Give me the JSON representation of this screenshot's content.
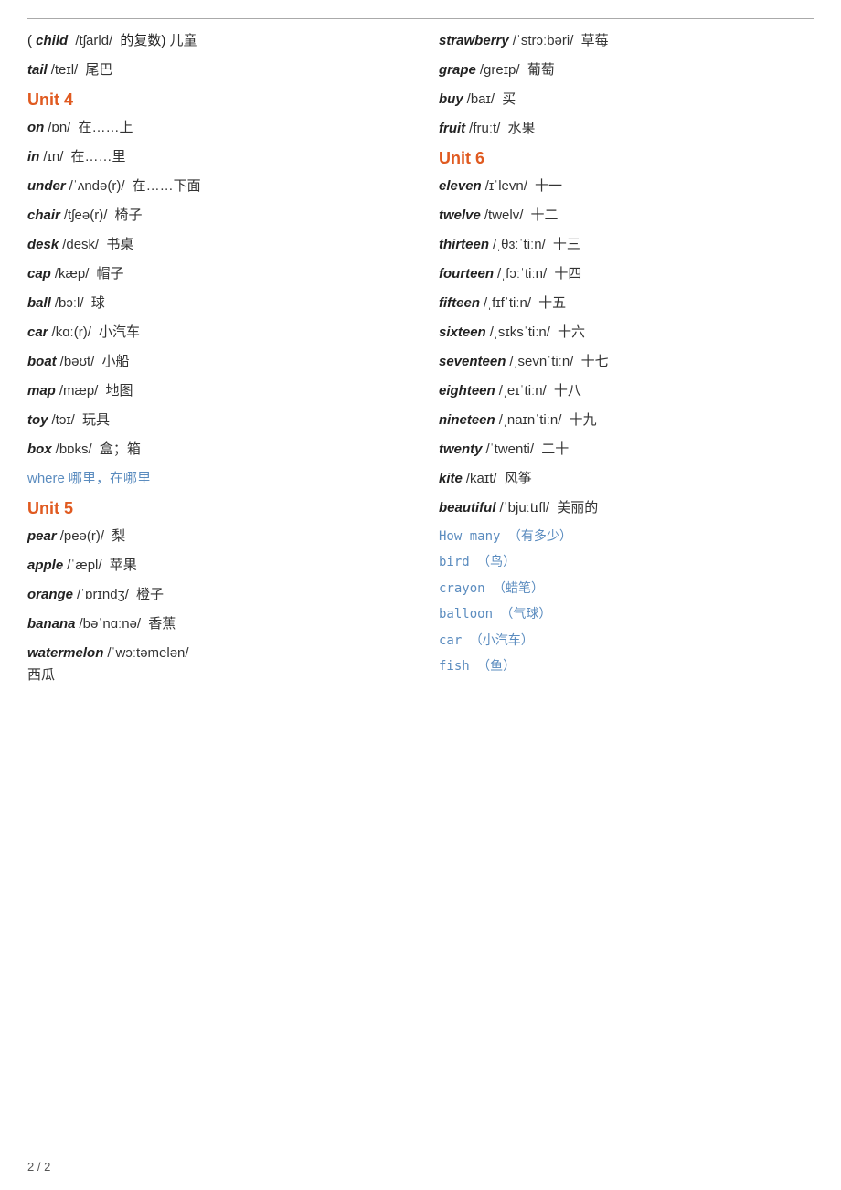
{
  "page": {
    "page_number": "2 / 2",
    "top_line": true
  },
  "left_column": [
    {
      "type": "entry",
      "word": "( child",
      "phonetic": "/tʃarld/",
      "note": "的复数)",
      "chinese": "儿童"
    },
    {
      "type": "entry",
      "word": "tail",
      "phonetic": "/teɪl/",
      "chinese": "尾巴"
    },
    {
      "type": "heading",
      "text": "Unit 4"
    },
    {
      "type": "entry",
      "word": "on",
      "phonetic": "/ɒn/",
      "chinese": "在……上"
    },
    {
      "type": "entry",
      "word": "in",
      "phonetic": "/ɪn/",
      "chinese": "在……里"
    },
    {
      "type": "entry",
      "word": "under",
      "phonetic": "/ˈʌndə(r)/",
      "chinese": "在……下面"
    },
    {
      "type": "entry",
      "word": "chair",
      "phonetic": "/tʃeə(r)/",
      "chinese": "椅子"
    },
    {
      "type": "entry",
      "word": "desk",
      "phonetic": "/desk/",
      "chinese": "书桌"
    },
    {
      "type": "entry",
      "word": "cap",
      "phonetic": "/kæp/",
      "chinese": "帽子"
    },
    {
      "type": "entry",
      "word": "ball",
      "phonetic": "/bɔːl/",
      "chinese": "球"
    },
    {
      "type": "entry",
      "word": "car",
      "phonetic": "/kɑː(r)/",
      "chinese": "小汽车"
    },
    {
      "type": "entry",
      "word": "boat",
      "phonetic": "/bəʊt/",
      "chinese": "小船"
    },
    {
      "type": "entry",
      "word": "map",
      "phonetic": "/mæp/",
      "chinese": "地图"
    },
    {
      "type": "entry",
      "word": "toy",
      "phonetic": "/tɔɪ/",
      "chinese": "玩具"
    },
    {
      "type": "entry",
      "word": "box",
      "phonetic": "/bɒks/",
      "chinese": "盒；箱"
    },
    {
      "type": "where",
      "text": "where    哪里，在哪里"
    },
    {
      "type": "heading",
      "text": "Unit 5"
    },
    {
      "type": "entry",
      "word": "pear",
      "phonetic": "/peə(r)/",
      "chinese": "梨"
    },
    {
      "type": "entry",
      "word": "apple",
      "phonetic": "/ˈæpl/",
      "chinese": "苹果"
    },
    {
      "type": "entry",
      "word": "orange",
      "phonetic": "/ˈɒrɪndʒ/",
      "chinese": "橙子"
    },
    {
      "type": "entry",
      "word": "banana",
      "phonetic": "/bəˈnɑːnə/",
      "chinese": "香蕉"
    },
    {
      "type": "entry-multiline",
      "word": "watermelon",
      "phonetic": "/ˈwɔːtəmelən/",
      "chinese": "西瓜"
    }
  ],
  "right_column": [
    {
      "type": "entry",
      "word": "strawberry",
      "phonetic": "/ˈstrɔːbəri/",
      "chinese": "草莓"
    },
    {
      "type": "entry",
      "word": "grape",
      "phonetic": "/greɪp/",
      "chinese": "葡萄"
    },
    {
      "type": "entry",
      "word": "buy",
      "phonetic": "/baɪ/",
      "chinese": "买"
    },
    {
      "type": "entry",
      "word": "fruit",
      "phonetic": "/fruːt/",
      "chinese": "水果"
    },
    {
      "type": "heading",
      "text": "Unit 6"
    },
    {
      "type": "entry",
      "word": "eleven",
      "phonetic": "/ɪˈlevn/",
      "chinese": "十一"
    },
    {
      "type": "entry",
      "word": "twelve",
      "phonetic": "/twelv/",
      "chinese": "十二"
    },
    {
      "type": "entry",
      "word": "thirteen",
      "phonetic": "/ˌθɜːˈtiːn/",
      "chinese": "十三"
    },
    {
      "type": "entry",
      "word": "fourteen",
      "phonetic": "/ˌfɔːˈtiːn/",
      "chinese": "十四"
    },
    {
      "type": "entry",
      "word": "fifteen",
      "phonetic": "/ˌfɪfˈtiːn/",
      "chinese": "十五"
    },
    {
      "type": "entry",
      "word": "sixteen",
      "phonetic": "/ˌsɪksˈtiːn/",
      "chinese": "十六"
    },
    {
      "type": "entry",
      "word": "seventeen",
      "phonetic": "/ˌsevnˈtiːn/",
      "chinese": "十七"
    },
    {
      "type": "entry",
      "word": "eighteen",
      "phonetic": "/ˌeɪˈtiːn/",
      "chinese": "十八"
    },
    {
      "type": "entry",
      "word": "nineteen",
      "phonetic": "/ˌnaɪnˈtiːn/",
      "chinese": "十九"
    },
    {
      "type": "entry",
      "word": "twenty",
      "phonetic": "/ˈtwenti/",
      "chinese": "二十"
    },
    {
      "type": "entry",
      "word": "kite",
      "phonetic": "/kaɪt/",
      "chinese": "风筝"
    },
    {
      "type": "entry",
      "word": "beautiful",
      "phonetic": "/ˈbjuːtɪfl/",
      "chinese": "美丽的"
    },
    {
      "type": "review",
      "text": "How many    （有多少）"
    },
    {
      "type": "review",
      "text": "bird    （鸟）"
    },
    {
      "type": "review",
      "text": "crayon    （蜡笔）"
    },
    {
      "type": "review",
      "text": "balloon    （气球）"
    },
    {
      "type": "review",
      "text": "car    （小汽车）"
    },
    {
      "type": "review",
      "text": "fish    （鱼）"
    }
  ]
}
